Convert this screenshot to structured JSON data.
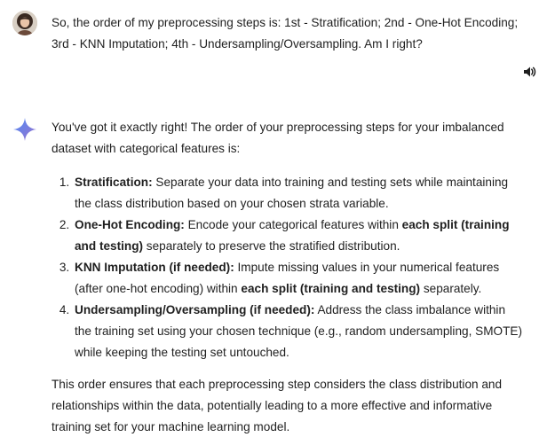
{
  "user_message": {
    "text": "So, the order of my preprocessing steps is: 1st - Stratification; 2nd - One-Hot Encoding; 3rd - KNN Imputation; 4th - Undersampling/Oversampling. Am I right?"
  },
  "icons": {
    "avatar": "user-avatar",
    "speaker": "speaker-icon",
    "model": "sparkle-icon"
  },
  "colors": {
    "spark_blue": "#4f8cf7",
    "spark_purple": "#9b72cb",
    "text": "#1f1f1f"
  },
  "response": {
    "intro": "You've got it exactly right! The order of your preprocessing steps for your imbalanced dataset with categorical features is:",
    "steps": [
      {
        "title": "Stratification:",
        "parts": [
          {
            "t": " Separate your data into training and testing sets while maintaining the class distribution based on your chosen strata variable.",
            "b": false
          }
        ]
      },
      {
        "title": "One-Hot Encoding:",
        "parts": [
          {
            "t": " Encode your categorical features within ",
            "b": false
          },
          {
            "t": "each split (training and testing)",
            "b": true
          },
          {
            "t": " separately to preserve the stratified distribution.",
            "b": false
          }
        ]
      },
      {
        "title": "KNN Imputation (if needed):",
        "parts": [
          {
            "t": " Impute missing values in your numerical features (after one-hot encoding) within ",
            "b": false
          },
          {
            "t": "each split (training and testing)",
            "b": true
          },
          {
            "t": " separately.",
            "b": false
          }
        ]
      },
      {
        "title": "Undersampling/Oversampling (if needed):",
        "parts": [
          {
            "t": " Address the class imbalance within the training set using your chosen technique (e.g., random undersampling, SMOTE) while keeping the testing set untouched.",
            "b": false
          }
        ]
      }
    ],
    "conclusion": "This order ensures that each preprocessing step considers the class distribution and relationships within the data, potentially leading to a more effective and informative training set for your machine learning model."
  }
}
